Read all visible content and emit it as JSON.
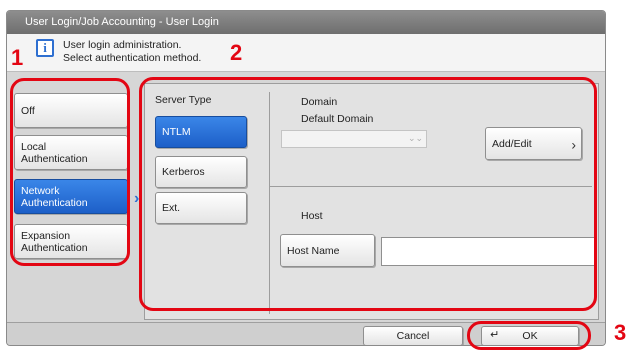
{
  "window": {
    "title": "User Login/Job Accounting - User Login"
  },
  "message": {
    "line1": "User login administration.",
    "line2": "Select authentication method."
  },
  "callouts": {
    "one": "1",
    "two": "2",
    "three": "3"
  },
  "auth_methods": [
    {
      "label_line1": "Off",
      "label_line2": "",
      "selected": false
    },
    {
      "label_line1": "Local",
      "label_line2": "Authentication",
      "selected": false
    },
    {
      "label_line1": "Network",
      "label_line2": "Authentication",
      "selected": true
    },
    {
      "label_line1": "Expansion",
      "label_line2": "Authentication",
      "selected": false
    }
  ],
  "server_type": {
    "label": "Server Type",
    "options": [
      "NTLM",
      "Kerberos",
      "Ext."
    ],
    "selected": "NTLM"
  },
  "domain": {
    "label": "Domain",
    "default_label": "Default Domain",
    "value": "",
    "add_edit_label": "Add/Edit"
  },
  "host": {
    "label": "Host",
    "host_name_button": "Host Name",
    "host_name_value": ""
  },
  "footer": {
    "cancel_label": "Cancel",
    "ok_label": "OK"
  },
  "icons": {
    "info": "info-icon",
    "enter": "enter-icon",
    "chevron": "chevron-right-icon"
  },
  "colors": {
    "selected_blue": "#1d5fc8",
    "callout_red": "#e30613",
    "title_gray": "#7a7a7a"
  }
}
